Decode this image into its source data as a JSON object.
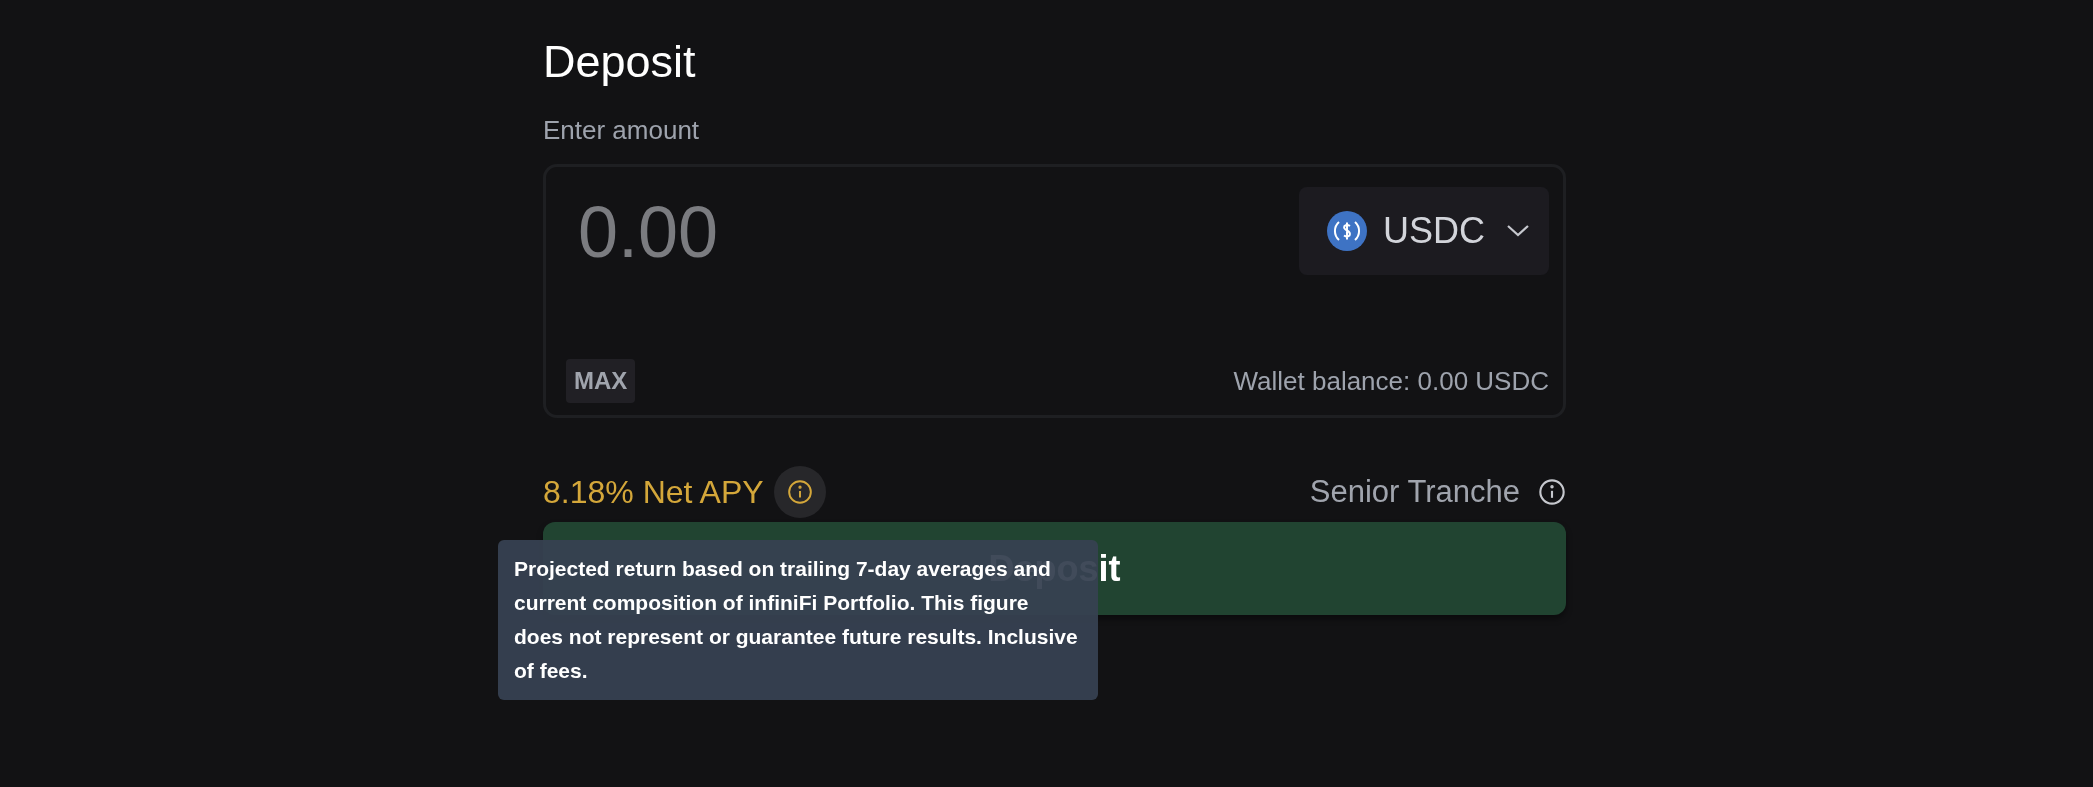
{
  "title": "Deposit",
  "amount": {
    "label": "Enter amount",
    "placeholder": "0.00",
    "max_button": "MAX",
    "token": {
      "symbol": "USDC"
    },
    "wallet_balance": "Wallet balance: 0.00 USDC"
  },
  "apy": {
    "text": "8.18% Net APY",
    "tranche": "Senior Tranche"
  },
  "deposit_button": "Deposit",
  "tooltip": {
    "text": "Projected return based on trailing 7-day averages and current composition of infiniFi Portfolio. This figure does not represent or guarantee future results. Inclusive of fees."
  }
}
